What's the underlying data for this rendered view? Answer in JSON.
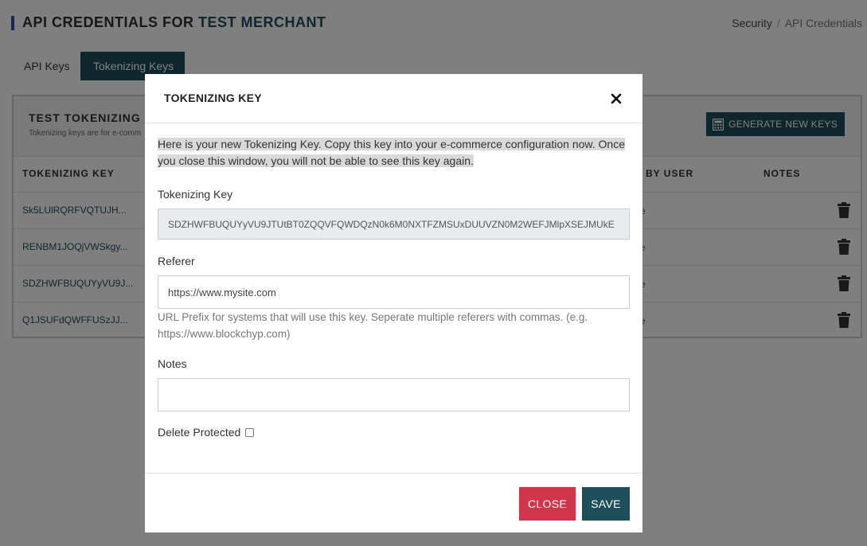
{
  "header": {
    "title_prefix": "API CREDENTIALS FOR",
    "merchant": "TEST MERCHANT",
    "breadcrumb": [
      "Security",
      "API Credentials"
    ]
  },
  "tabs": [
    {
      "label": "API Keys",
      "active": false
    },
    {
      "label": "Tokenizing Keys",
      "active": true
    }
  ],
  "card": {
    "title": "TEST TOKENIZING K",
    "subtitle": "Tokenizing keys are for e-comm",
    "generate_button": "GENERATE NEW KEYS",
    "columns": [
      "TOKENIZING KEY",
      "D BY USER",
      "NOTES"
    ],
    "rows": [
      {
        "key": "Sk5LUlRQRFVQTUJH...",
        "user": "e"
      },
      {
        "key": "RENBM1JOQjVWSkgy...",
        "user": "e"
      },
      {
        "key": "SDZHWFBUQUYyVU9J...",
        "user": "e"
      },
      {
        "key": "Q1JSUFdQWFFUSzJJ...",
        "user": "e"
      }
    ]
  },
  "modal": {
    "title": "TOKENIZING KEY",
    "notice": "Here is your new Tokenizing Key. Copy this key into your e-commerce configuration now. Once you close this window, you will not be able to see this key again.",
    "key_label": "Tokenizing Key",
    "key_value": "SDZHWFBUQUYyVU9JTUtBT0ZQQVFQWDQzN0k6M0NXTFZMSUxDUUVZN0M2WEFJMlpXSEJMUkE",
    "referer_label": "Referer",
    "referer_value": "https://www.mysite.com",
    "referer_help": "URL Prefix for systems that will use this key. Seperate multiple referers with commas. (e.g. https://www.blockchyp.com)",
    "notes_label": "Notes",
    "notes_value": "",
    "delete_protected_label": "Delete Protected",
    "delete_protected": false,
    "close_button": "CLOSE",
    "save_button": "SAVE"
  },
  "colors": {
    "brand_teal": "#1d4f5b",
    "danger": "#d0354a",
    "accent_bar": "#3a4fa3"
  },
  "icons": [
    "calculator-icon",
    "trash-icon",
    "close-icon"
  ]
}
